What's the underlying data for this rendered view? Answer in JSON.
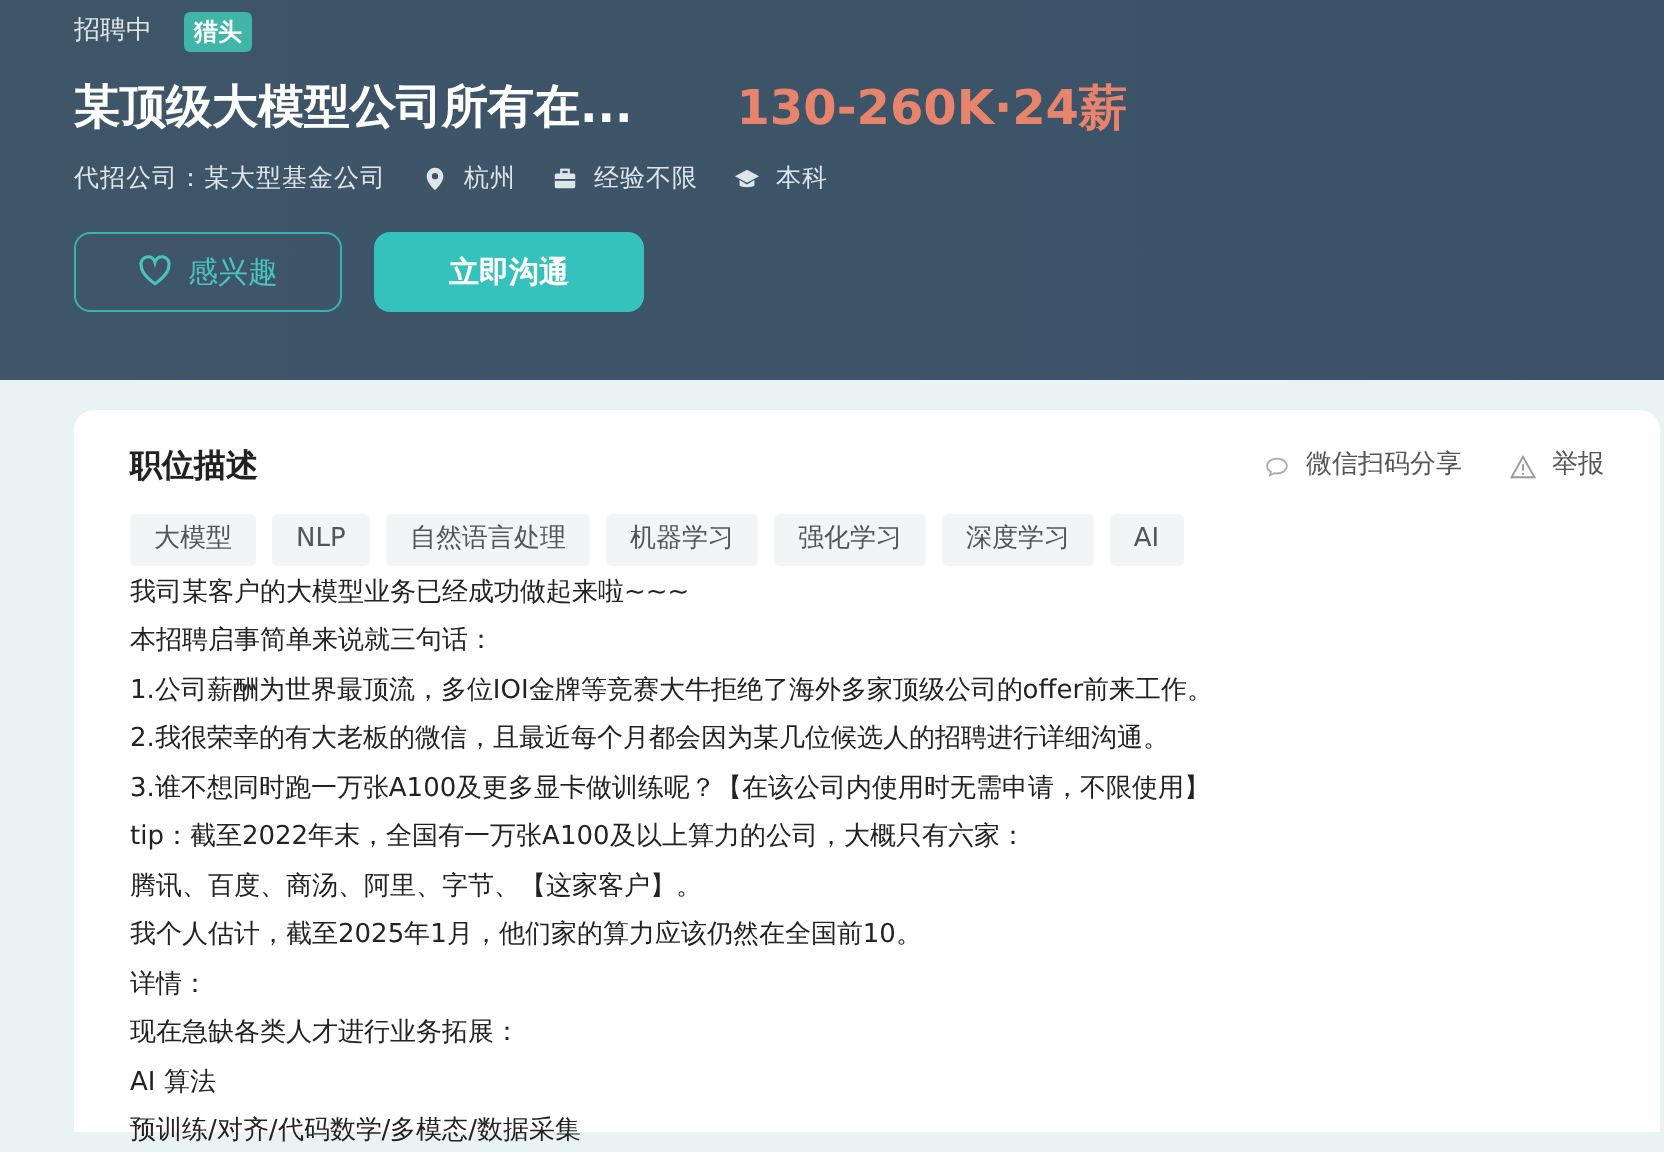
{
  "header": {
    "status": "招聘中",
    "badge": "猎头",
    "title": "某顶级大模型公司所有在...",
    "salary": "130-260K·24薪",
    "meta": [
      {
        "kind": "company",
        "text": "代招公司：某大型基金公司"
      },
      {
        "kind": "location",
        "text": "杭州"
      },
      {
        "kind": "experience",
        "text": "经验不限"
      },
      {
        "kind": "education",
        "text": "本科"
      }
    ],
    "buttons": [
      {
        "kind": "interest",
        "label": "感兴趣"
      },
      {
        "kind": "chat",
        "label": "立即沟通"
      }
    ]
  },
  "description": {
    "title": "职位描述",
    "actions": [
      {
        "kind": "share",
        "label": "微信扫码分享"
      },
      {
        "kind": "report",
        "label": "举报"
      }
    ],
    "tags": [
      "大模型",
      "NLP",
      "自然语言处理",
      "机器学习",
      "强化学习",
      "深度学习",
      "AI"
    ],
    "lines": [
      "我司某客户的大模型业务已经成功做起来啦~~~",
      "本招聘启事简单来说就三句话：",
      "1.公司薪酬为世界最顶流，多位IOI金牌等竞赛大牛拒绝了海外多家顶级公司的offer前来工作。",
      "2.我很荣幸的有大老板的微信，且最近每个月都会因为某几位候选人的招聘进行详细沟通。",
      "3.谁不想同时跑一万张A100及更多显卡做训练呢？【在该公司内使用时无需申请，不限使用】",
      "tip：截至2022年末，全国有一万张A100及以上算力的公司，大概只有六家：",
      "腾讯、百度、商汤、阿里、字节、【这家客户】。",
      "我个人估计，截至2025年1月，他们家的算力应该仍然在全国前10。",
      "详情：",
      "现在急缺各类人才进行业务拓展：",
      "AI 算法",
      "预训练/对齐/代码数学/多模态/数据采集"
    ]
  }
}
